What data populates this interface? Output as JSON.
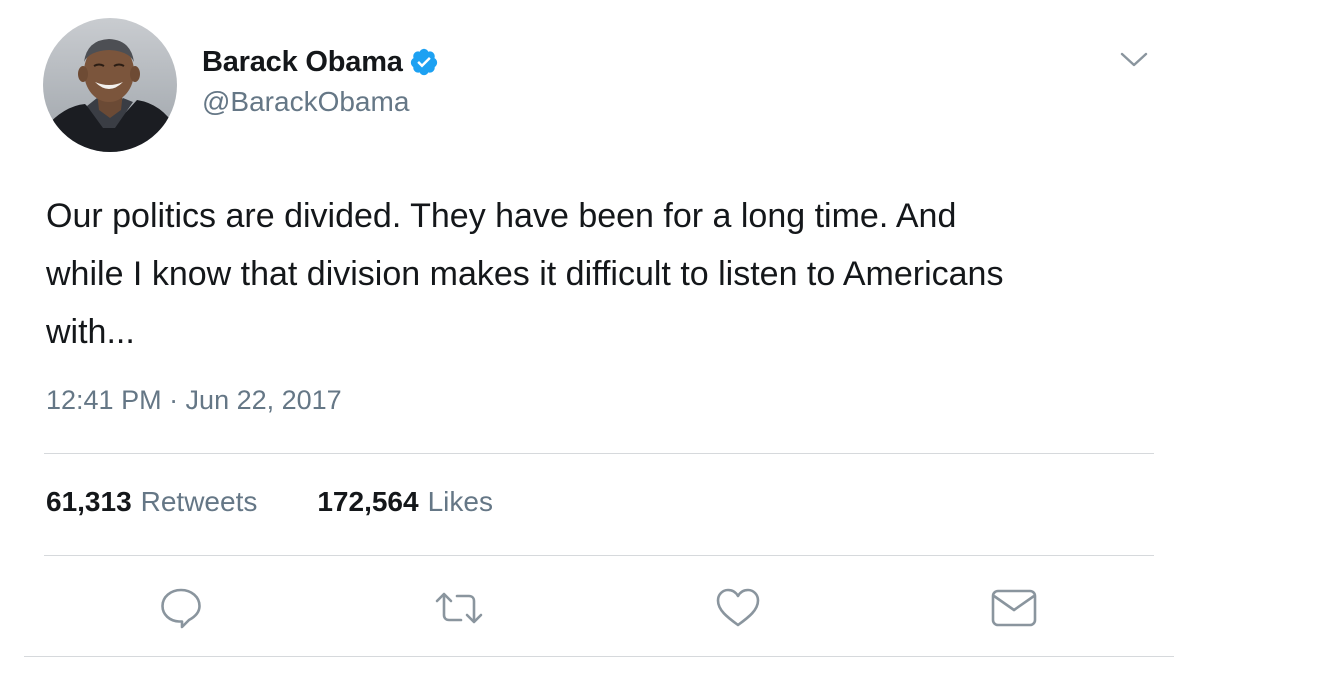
{
  "tweet": {
    "author": {
      "display_name": "Barack Obama",
      "handle": "@BarackObama",
      "verified": true
    },
    "text_lines": [
      "Our politics are divided. They have been for a long time. And",
      "while I know that division makes it difficult to listen to Americans",
      "with..."
    ],
    "timestamp": "12:41 PM · Jun 22, 2017",
    "stats": {
      "retweets_count": "61,313",
      "retweets_label": "Retweets",
      "likes_count": "172,564",
      "likes_label": "Likes"
    },
    "icons": {
      "menu": "chevron-down-icon",
      "verified": "verified-badge-icon",
      "reply": "reply-icon",
      "retweet": "retweet-icon",
      "like": "heart-icon",
      "dm": "mail-icon"
    }
  },
  "colors": {
    "verified_blue": "#1da1f2",
    "secondary_text": "#657786",
    "primary_text": "#14171a",
    "divider": "#d6d9dc"
  }
}
